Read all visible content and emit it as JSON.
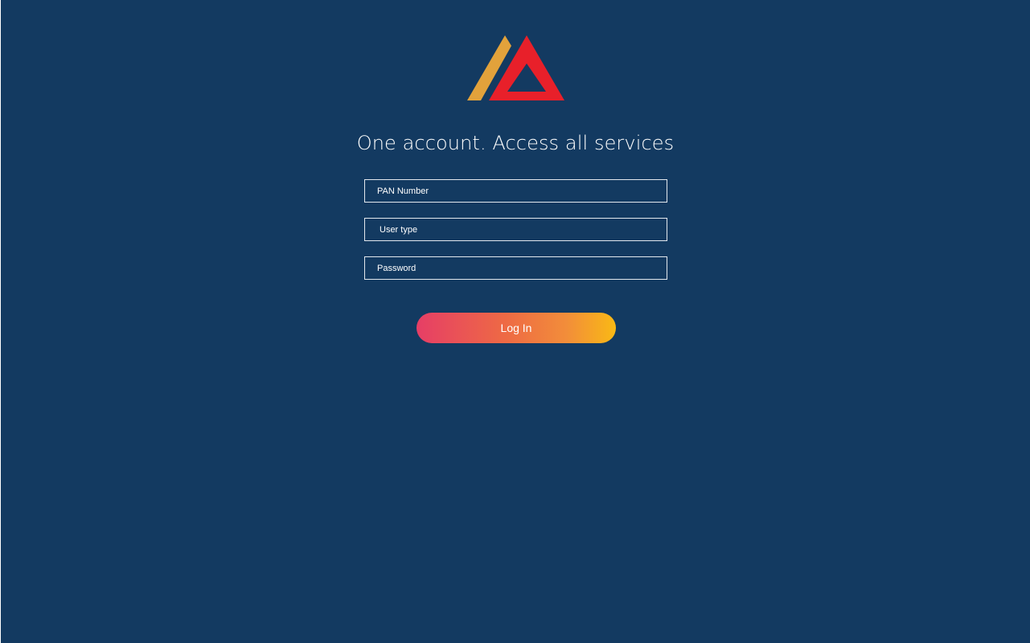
{
  "brand": {
    "logo_icon": "triangle-peaks-logo",
    "colors": {
      "background": "#133a61",
      "logo_gold": "#e2a23b",
      "logo_red": "#e8202a",
      "button_gradient_start": "#e63e66",
      "button_gradient_end": "#f9b915"
    }
  },
  "tagline": "One account. Access all services",
  "form": {
    "pan_placeholder": "PAN Number",
    "user_type_placeholder": "User type",
    "password_placeholder": "Password",
    "login_label": "Log In"
  }
}
